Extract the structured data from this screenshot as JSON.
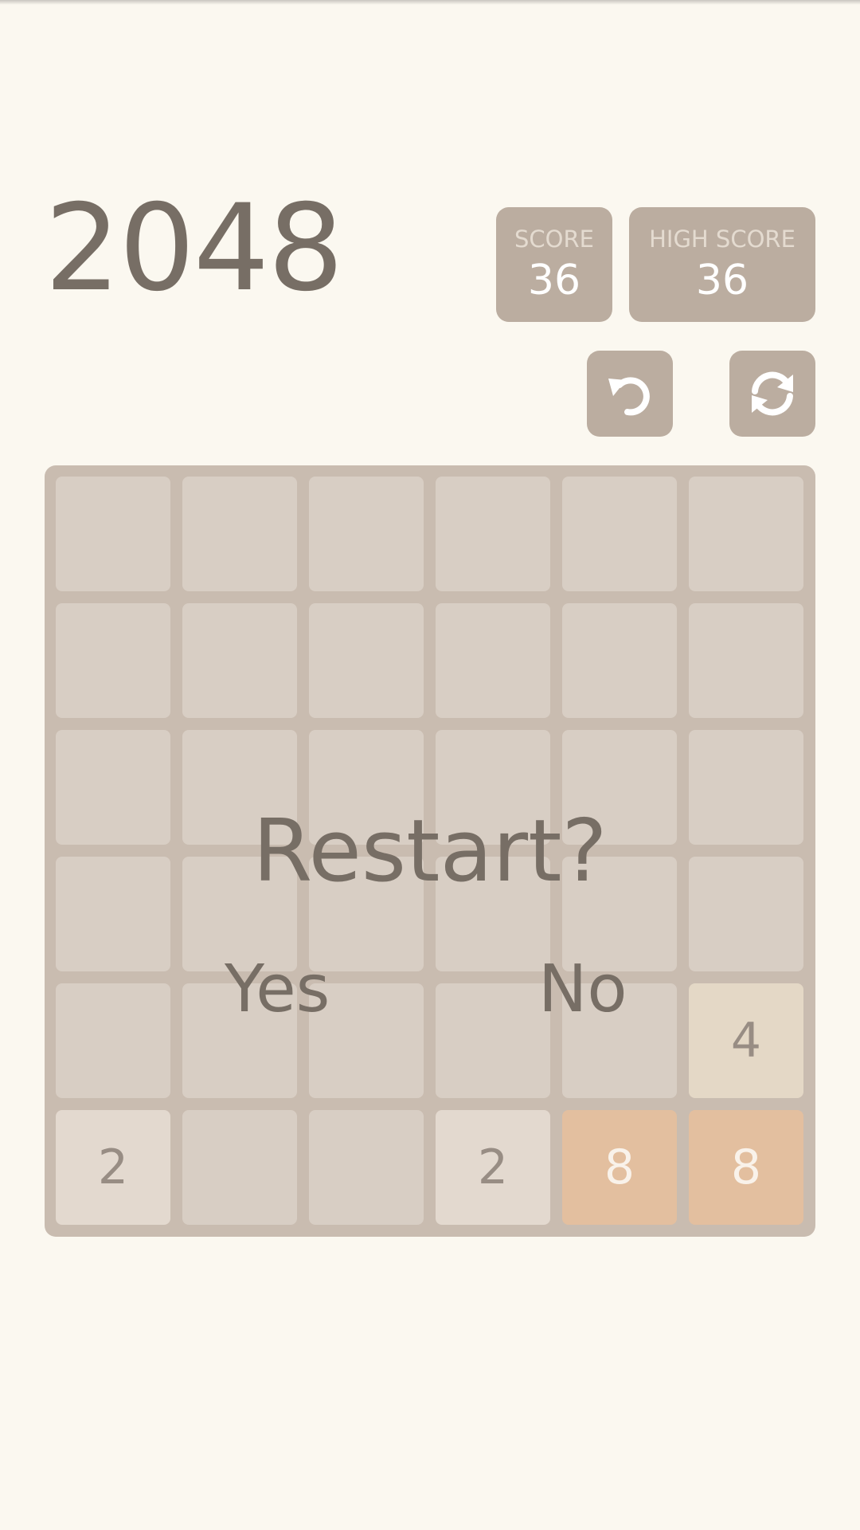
{
  "header": {
    "title": "2048"
  },
  "scores": {
    "score_label": "SCORE",
    "score_value": "36",
    "best_label": "HIGH SCORE",
    "best_value": "36"
  },
  "controls": {
    "undo_icon": "undo-icon",
    "restart_icon": "refresh-icon"
  },
  "board": {
    "rows": [
      [
        "",
        "",
        "",
        "",
        "",
        ""
      ],
      [
        "",
        "",
        "",
        "",
        "",
        ""
      ],
      [
        "",
        "",
        "",
        "",
        "",
        ""
      ],
      [
        "",
        "",
        "",
        "",
        "",
        ""
      ],
      [
        "",
        "",
        "",
        "",
        "",
        "4"
      ],
      [
        "2",
        "",
        "",
        "2",
        "8",
        "8"
      ]
    ]
  },
  "dialog": {
    "question": "Restart?",
    "yes_label": "Yes",
    "no_label": "No"
  },
  "colors": {
    "background": "#fbf8f0",
    "board": "#c9bcb0",
    "empty_cell": "#d8cec4",
    "tile_2": "#e3d9cf",
    "tile_4": "#e4d8c6",
    "tile_8": "#e3bf9f",
    "text_dark": "#776e65",
    "score_box": "#bbada0"
  }
}
